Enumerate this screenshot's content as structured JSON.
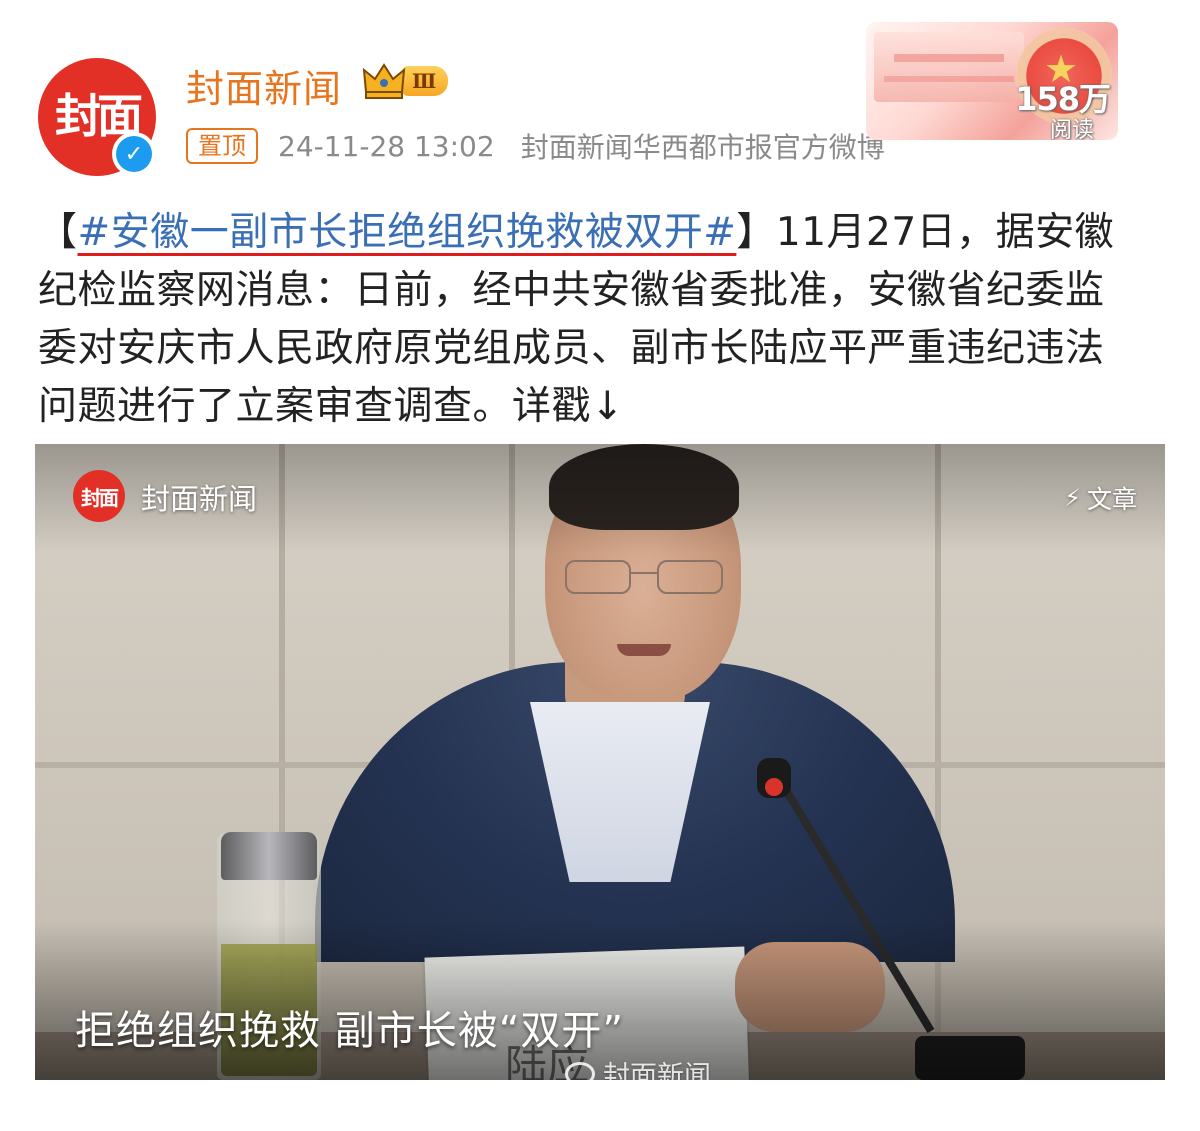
{
  "header": {
    "avatar_text": "封面",
    "account_name": "封面新闻",
    "vip_level": "Ⅲ",
    "pin_label": "置顶",
    "post_time": "24-11-28 13:02",
    "account_description": "封面新闻华西都市报官方微博",
    "read_count": "158万",
    "read_label": "阅读"
  },
  "post": {
    "bracket_open": "【",
    "hashtag": "#安徽一副市长拒绝组织挽救被双开#",
    "bracket_close": "】",
    "line1_rest": "11月27日，据安徽",
    "line2": "纪检监察网消息：日前，经中共安徽省委批准，安徽省纪委监",
    "line3": "委对安庆市人民政府原党组成员、副市长陆应平严重违纪违法",
    "line4": "问题进行了立案审查调查。详戳↓"
  },
  "media": {
    "logo_text": "封面",
    "source": "封面新闻",
    "type_label": "文章",
    "caption": "拒绝组织挽救 副市长被“双开”",
    "watermark": "封面新闻",
    "nameplate": "陆应"
  },
  "icons": {
    "verified": "verified-v-icon",
    "crown": "crown-icon",
    "bolt": "lightning-icon",
    "weibo": "weibo-logo-icon"
  },
  "colors": {
    "brand_red": "#e33027",
    "account_orange": "#e8751e",
    "hashtag_blue": "#3a6fb5",
    "underline_red": "#e01b1b",
    "verified_blue": "#1d9bf0"
  }
}
